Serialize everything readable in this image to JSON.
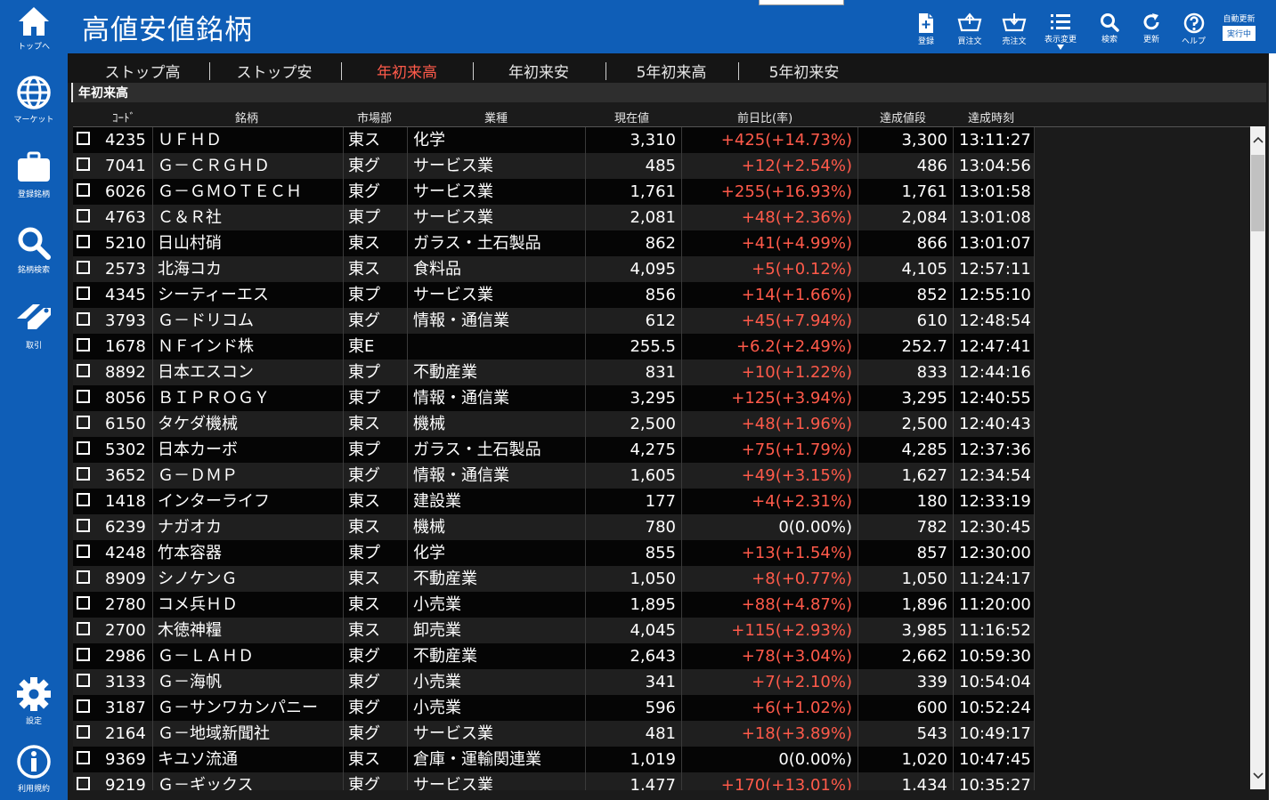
{
  "app": {
    "title": "高値安値銘柄"
  },
  "sidebar": {
    "items": [
      {
        "label": "トップへ",
        "icon": "home-icon"
      },
      {
        "label": "マーケット",
        "icon": "globe-icon"
      },
      {
        "label": "登録銘柄",
        "icon": "briefcase-icon"
      },
      {
        "label": "銘柄検索",
        "icon": "search-icon"
      },
      {
        "label": "取引",
        "icon": "trade-icon"
      },
      {
        "label": "設定",
        "icon": "gear-icon"
      },
      {
        "label": "利用規約",
        "icon": "info-icon"
      }
    ]
  },
  "toolbar": {
    "buttons": [
      {
        "label": "登録",
        "icon": "register-icon"
      },
      {
        "label": "買注文",
        "icon": "buy-order-icon"
      },
      {
        "label": "売注文",
        "icon": "sell-order-icon"
      },
      {
        "label": "表示変更",
        "icon": "list-view-icon"
      },
      {
        "label": "検索",
        "icon": "search-icon"
      },
      {
        "label": "更新",
        "icon": "refresh-icon"
      },
      {
        "label": "ヘルプ",
        "icon": "help-icon"
      }
    ],
    "auto_update_label": "自動更新",
    "auto_update_state": "実行中"
  },
  "tabs": [
    "ストップ高",
    "ストップ安",
    "年初来高",
    "年初来安",
    "5年初来高",
    "5年初来安"
  ],
  "active_tab": "年初来高",
  "section_title": "年初来高",
  "columns": [
    "ｺｰﾄﾞ",
    "銘柄",
    "市場部",
    "業種",
    "現在値",
    "前日比(率)",
    "達成値段",
    "達成時刻"
  ],
  "rows": [
    {
      "code": "4235",
      "name": "ＵＦＨＤ",
      "market": "東ス",
      "sector": "化学",
      "price": "3,310",
      "change": "+425(+14.73%)",
      "hit_price": "3,300",
      "time": "13:11:27"
    },
    {
      "code": "7041",
      "name": "Ｇ－ＣＲＧＨＤ",
      "market": "東グ",
      "sector": "サービス業",
      "price": "485",
      "change": "+12(+2.54%)",
      "hit_price": "486",
      "time": "13:04:56"
    },
    {
      "code": "6026",
      "name": "Ｇ－ＧＭＯＴＥＣＨ",
      "market": "東グ",
      "sector": "サービス業",
      "price": "1,761",
      "change": "+255(+16.93%)",
      "hit_price": "1,761",
      "time": "13:01:58"
    },
    {
      "code": "4763",
      "name": "Ｃ＆Ｒ社",
      "market": "東プ",
      "sector": "サービス業",
      "price": "2,081",
      "change": "+48(+2.36%)",
      "hit_price": "2,084",
      "time": "13:01:08"
    },
    {
      "code": "5210",
      "name": "日山村硝",
      "market": "東ス",
      "sector": "ガラス・土石製品",
      "price": "862",
      "change": "+41(+4.99%)",
      "hit_price": "866",
      "time": "13:01:07"
    },
    {
      "code": "2573",
      "name": "北海コカ",
      "market": "東ス",
      "sector": "食料品",
      "price": "4,095",
      "change": "+5(+0.12%)",
      "hit_price": "4,105",
      "time": "12:57:11"
    },
    {
      "code": "4345",
      "name": "シーティーエス",
      "market": "東プ",
      "sector": "サービス業",
      "price": "856",
      "change": "+14(+1.66%)",
      "hit_price": "852",
      "time": "12:55:10"
    },
    {
      "code": "3793",
      "name": "Ｇ－ドリコム",
      "market": "東グ",
      "sector": "情報・通信業",
      "price": "612",
      "change": "+45(+7.94%)",
      "hit_price": "610",
      "time": "12:48:54"
    },
    {
      "code": "1678",
      "name": "ＮＦインド株",
      "market": "東E",
      "sector": "",
      "price": "255.5",
      "change": "+6.2(+2.49%)",
      "hit_price": "252.7",
      "time": "12:47:41"
    },
    {
      "code": "8892",
      "name": "日本エスコン",
      "market": "東プ",
      "sector": "不動産業",
      "price": "831",
      "change": "+10(+1.22%)",
      "hit_price": "833",
      "time": "12:44:16"
    },
    {
      "code": "8056",
      "name": "ＢＩＰＲＯＧＹ",
      "market": "東プ",
      "sector": "情報・通信業",
      "price": "3,295",
      "change": "+125(+3.94%)",
      "hit_price": "3,295",
      "time": "12:40:55"
    },
    {
      "code": "6150",
      "name": "タケダ機械",
      "market": "東ス",
      "sector": "機械",
      "price": "2,500",
      "change": "+48(+1.96%)",
      "hit_price": "2,500",
      "time": "12:40:43"
    },
    {
      "code": "5302",
      "name": "日本カーボ",
      "market": "東プ",
      "sector": "ガラス・土石製品",
      "price": "4,275",
      "change": "+75(+1.79%)",
      "hit_price": "4,285",
      "time": "12:37:36"
    },
    {
      "code": "3652",
      "name": "Ｇ－ＤＭＰ",
      "market": "東グ",
      "sector": "情報・通信業",
      "price": "1,605",
      "change": "+49(+3.15%)",
      "hit_price": "1,627",
      "time": "12:34:54"
    },
    {
      "code": "1418",
      "name": "インターライフ",
      "market": "東ス",
      "sector": "建設業",
      "price": "177",
      "change": "+4(+2.31%)",
      "hit_price": "180",
      "time": "12:33:19"
    },
    {
      "code": "6239",
      "name": "ナガオカ",
      "market": "東ス",
      "sector": "機械",
      "price": "780",
      "change": "0(0.00%)",
      "hit_price": "782",
      "time": "12:30:45"
    },
    {
      "code": "4248",
      "name": "竹本容器",
      "market": "東プ",
      "sector": "化学",
      "price": "855",
      "change": "+13(+1.54%)",
      "hit_price": "857",
      "time": "12:30:00"
    },
    {
      "code": "8909",
      "name": "シノケンＧ",
      "market": "東ス",
      "sector": "不動産業",
      "price": "1,050",
      "change": "+8(+0.77%)",
      "hit_price": "1,050",
      "time": "11:24:17"
    },
    {
      "code": "2780",
      "name": "コメ兵ＨＤ",
      "market": "東ス",
      "sector": "小売業",
      "price": "1,895",
      "change": "+88(+4.87%)",
      "hit_price": "1,896",
      "time": "11:20:00"
    },
    {
      "code": "2700",
      "name": "木徳神糧",
      "market": "東ス",
      "sector": "卸売業",
      "price": "4,045",
      "change": "+115(+2.93%)",
      "hit_price": "3,985",
      "time": "11:16:52"
    },
    {
      "code": "2986",
      "name": "Ｇ－ＬＡＨＤ",
      "market": "東グ",
      "sector": "不動産業",
      "price": "2,643",
      "change": "+78(+3.04%)",
      "hit_price": "2,662",
      "time": "10:59:30"
    },
    {
      "code": "3133",
      "name": "Ｇ－海帆",
      "market": "東グ",
      "sector": "小売業",
      "price": "341",
      "change": "+7(+2.10%)",
      "hit_price": "339",
      "time": "10:54:04"
    },
    {
      "code": "3187",
      "name": "Ｇ－サンワカンパニー",
      "market": "東グ",
      "sector": "小売業",
      "price": "596",
      "change": "+6(+1.02%)",
      "hit_price": "600",
      "time": "10:52:24"
    },
    {
      "code": "2164",
      "name": "Ｇ－地域新聞社",
      "market": "東グ",
      "sector": "サービス業",
      "price": "481",
      "change": "+18(+3.89%)",
      "hit_price": "543",
      "time": "10:49:17"
    },
    {
      "code": "9369",
      "name": "キユソ流通",
      "market": "東ス",
      "sector": "倉庫・運輸関連業",
      "price": "1,019",
      "change": "0(0.00%)",
      "hit_price": "1,020",
      "time": "10:47:45"
    },
    {
      "code": "9219",
      "name": "Ｇ－ギックス",
      "market": "東グ",
      "sector": "サービス業",
      "price": "1,477",
      "change": "+170(+13.01%)",
      "hit_price": "1,434",
      "time": "10:35:27"
    }
  ],
  "colors": {
    "brand_blue": "#0f5eb7",
    "up_red": "#ff5a4a",
    "row_dark": "#050505",
    "row_alt": "#1f1f1f"
  }
}
